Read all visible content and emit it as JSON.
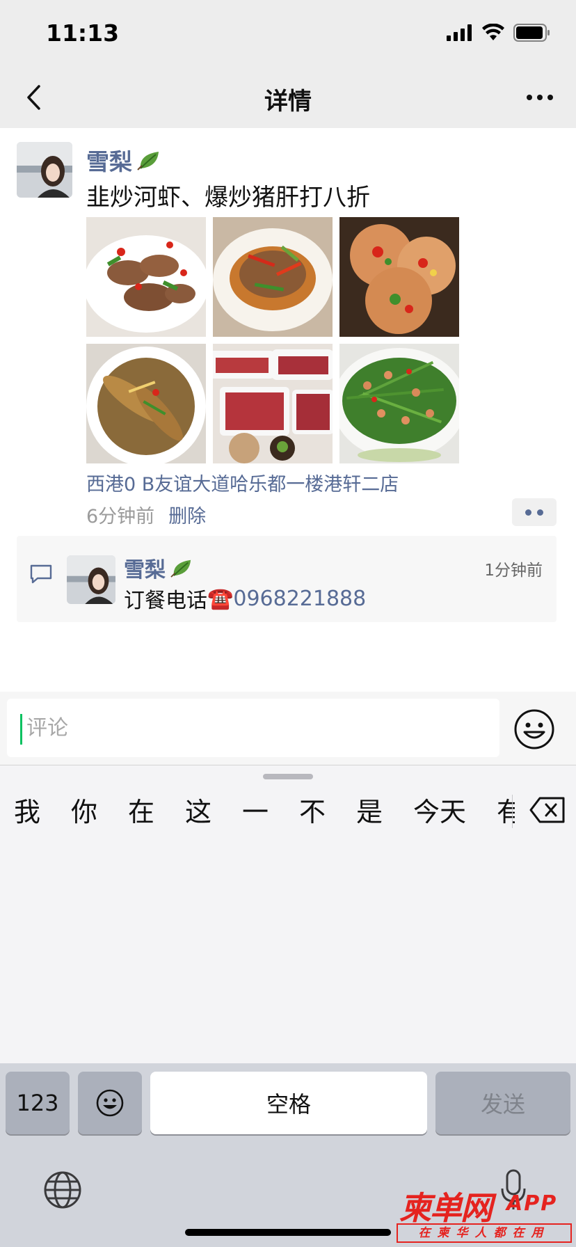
{
  "status_bar": {
    "time": "11:13"
  },
  "nav": {
    "title": "详情"
  },
  "post": {
    "author": "雪梨",
    "text": "韭炒河虾、爆炒猪肝打八折",
    "photos": [
      {
        "alt": "stir-fried liver dish"
      },
      {
        "alt": "stir-fried pork with peppers"
      },
      {
        "alt": "egg pancakes with peppers"
      },
      {
        "alt": "braised fish with chili"
      },
      {
        "alt": "raw beef slices platter"
      },
      {
        "alt": "chive and shrimp stir-fry"
      }
    ],
    "location": "西港0 B友谊大道哈乐都一楼港轩二店",
    "time": "6分钟前",
    "delete_label": "删除"
  },
  "comment": {
    "author": "雪梨",
    "time": "1分钟前",
    "text_prefix": "订餐电话",
    "phone_emoji": "☎️",
    "phone": "0968221888"
  },
  "input": {
    "placeholder": "评论"
  },
  "keyboard": {
    "candidates": [
      "我",
      "你",
      "在",
      "这",
      "一",
      "不",
      "是",
      "今天",
      "有"
    ],
    "key_123": "123",
    "key_space": "空格",
    "key_send": "发送"
  },
  "watermark": {
    "main": "柬单网",
    "app": "APP",
    "slogan": "在柬华人都在用"
  },
  "colors": {
    "link": "#576b95",
    "accent": "#07c160",
    "watermark": "#e5231f"
  }
}
